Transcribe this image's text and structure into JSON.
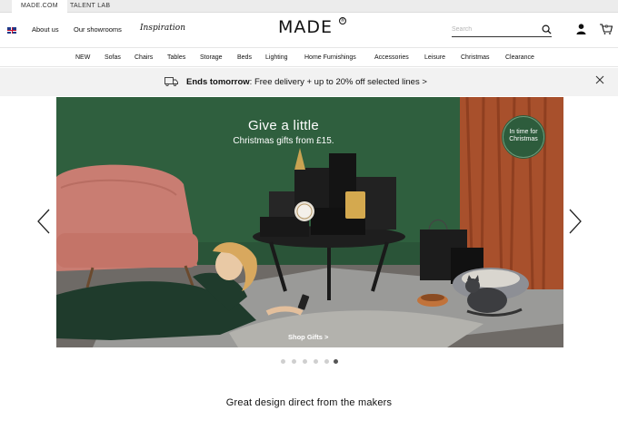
{
  "utility_bar": {
    "tabs": [
      {
        "label": "MADE.COM",
        "active": true
      },
      {
        "label": "TALENT LAB",
        "active": false
      }
    ]
  },
  "header": {
    "flag_icon": "uk-flag-icon",
    "links": {
      "about": "About us",
      "showrooms": "Our showrooms",
      "inspiration": "Inspiration"
    },
    "logo": "MADE",
    "logo_mark": "®",
    "search": {
      "placeholder": "Search",
      "icon": "search-icon"
    },
    "account_icon": "person-icon",
    "basket": {
      "icon": "basket-icon",
      "count": "0"
    }
  },
  "categories": [
    "NEW",
    "Sofas",
    "Chairs",
    "Tables",
    "Storage",
    "Beds",
    "Lighting",
    "Home Furnishings",
    "Accessories",
    "Leisure",
    "Christmas",
    "Clearance"
  ],
  "promo": {
    "icon": "truck-icon",
    "bold": "Ends tomorrow",
    "text": ": Free delivery + up to 20% off selected lines >",
    "close_icon": "close-icon"
  },
  "hero": {
    "title": "Give a little",
    "subtitle": "Christmas gifts from £15.",
    "badge": "In time for Christmas",
    "cta": "Shop Gifts >"
  },
  "carousel": {
    "slides": 6,
    "active_index": 5
  },
  "tagline": "Great design direct from the makers",
  "colors": {
    "wall_green": "#2f5f3e",
    "curtain_rust": "#a8502c",
    "chair_pink": "#c97d72",
    "rug_grey": "#8a8a8a"
  }
}
